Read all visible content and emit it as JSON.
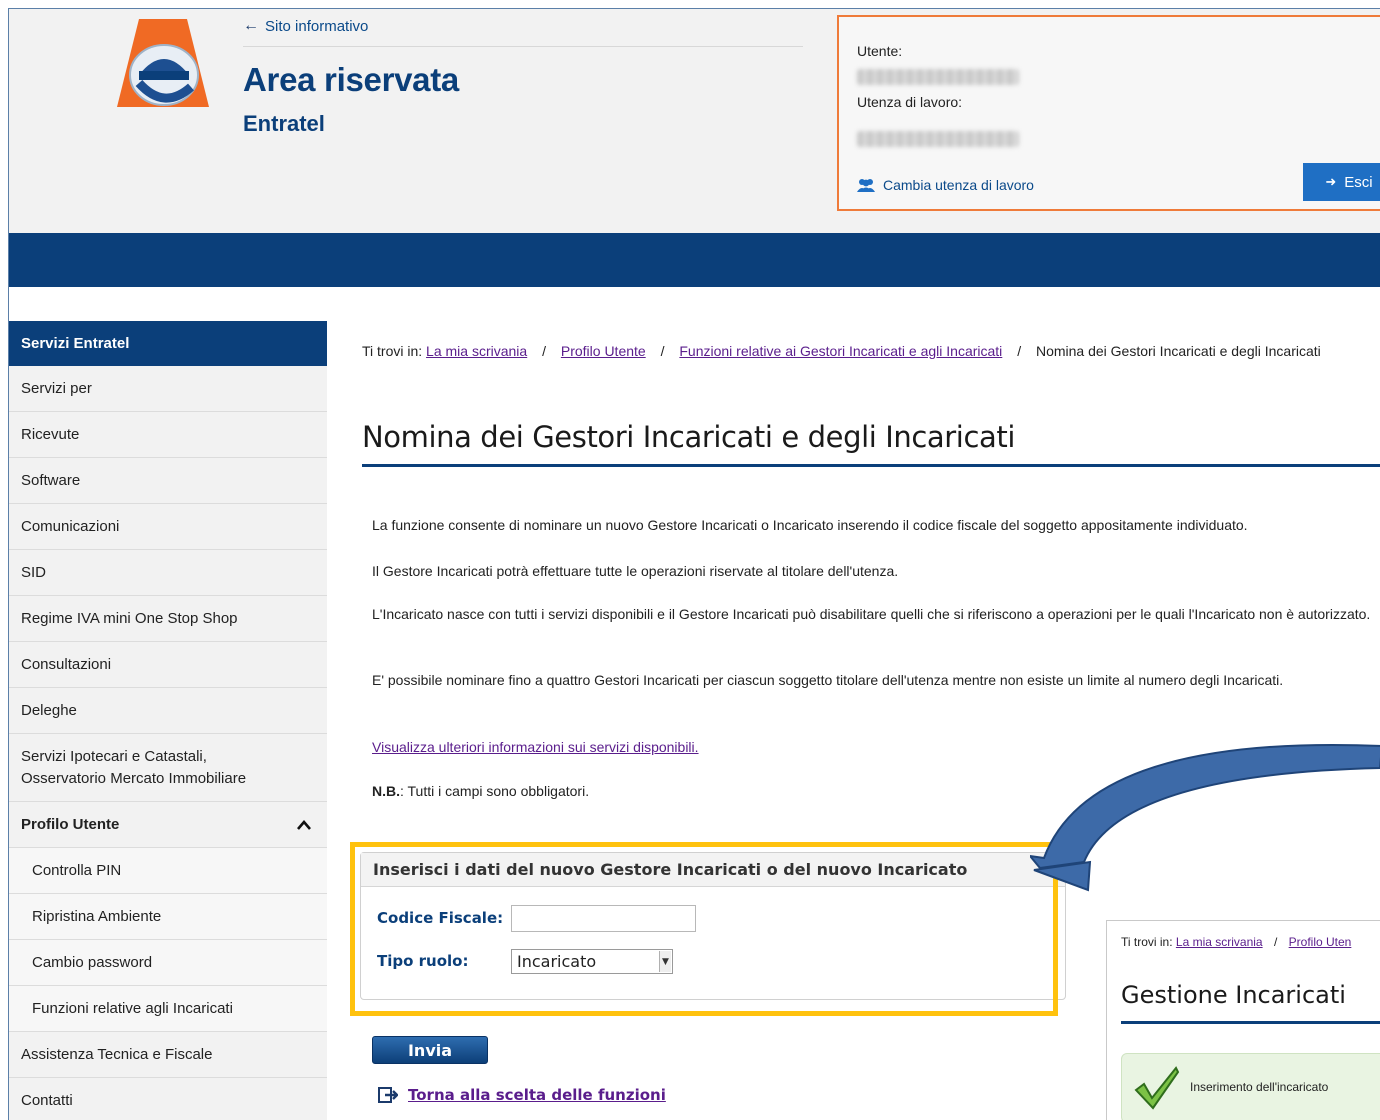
{
  "header": {
    "back_link": "Sito informativo",
    "area_title": "Area riservata",
    "area_subtitle": "Entratel",
    "user_label": "Utente:",
    "work_user_label": "Utenza di lavoro:",
    "change_work_user": "Cambia utenza di lavoro",
    "logout": "Esci"
  },
  "sidebar": {
    "header": "Servizi Entratel",
    "items": [
      "Servizi per",
      "Ricevute",
      "Software",
      "Comunicazioni",
      "SID",
      "Regime IVA mini One Stop Shop",
      "Consultazioni",
      "Deleghe",
      "Servizi Ipotecari e Catastali, Osservatorio Mercato Immobiliare"
    ],
    "profile_section": "Profilo Utente",
    "profile_items": [
      "Controlla PIN",
      "Ripristina Ambiente",
      "Cambio password",
      "Funzioni relative agli Incaricati"
    ],
    "bottom_items": [
      "Assistenza Tecnica e Fiscale",
      "Contatti"
    ]
  },
  "breadcrumb": {
    "prefix": "Ti trovi in:",
    "links": [
      "La mia scrivania",
      "Profilo Utente",
      "Funzioni relative ai Gestori Incaricati e agli Incaricati"
    ],
    "current": "Nomina dei Gestori Incaricati e degli Incaricati"
  },
  "main": {
    "title": "Nomina dei Gestori Incaricati e degli Incaricati",
    "paragraphs": [
      "La funzione consente di nominare un nuovo Gestore Incaricati o Incaricato inserendo il codice fiscale del soggetto appositamente individuato.",
      "Il Gestore Incaricati potrà effettuare tutte le operazioni riservate al titolare dell'utenza.",
      "L'Incaricato nasce con tutti i servizi disponibili e il Gestore Incaricati può disabilitare quelli che si riferiscono a operazioni per le quali l'Incaricato non è autorizzato.",
      "E' possibile nominare fino a quattro Gestori Incaricati per ciascun soggetto titolare dell'utenza mentre non esiste un limite al numero degli Incaricati."
    ],
    "more_info_link": "Visualizza ulteriori informazioni sui servizi disponibili.",
    "nb_label": "N.B.",
    "nb_text": ": Tutti i campi sono obbligatori."
  },
  "form": {
    "heading": "Inserisci i dati del nuovo Gestore Incaricati o del nuovo Incaricato",
    "cf_label": "Codice Fiscale:",
    "cf_value": "",
    "role_label": "Tipo ruolo:",
    "role_value": "Incaricato",
    "submit": "Invia",
    "back_link": "Torna alla scelta delle funzioni"
  },
  "inset": {
    "breadcrumb_prefix": "Ti trovi in:",
    "breadcrumb_link1": "La mia scrivania",
    "breadcrumb_link2": "Profilo Uten",
    "title": "Gestione Incaricati",
    "alert": "Inserimento dell'incaricato"
  },
  "colors": {
    "brand_blue": "#0b3f7a",
    "highlight_orange": "#ef7b3a",
    "highlight_yellow": "#ffc20e",
    "link_purple": "#5a1d8c"
  }
}
